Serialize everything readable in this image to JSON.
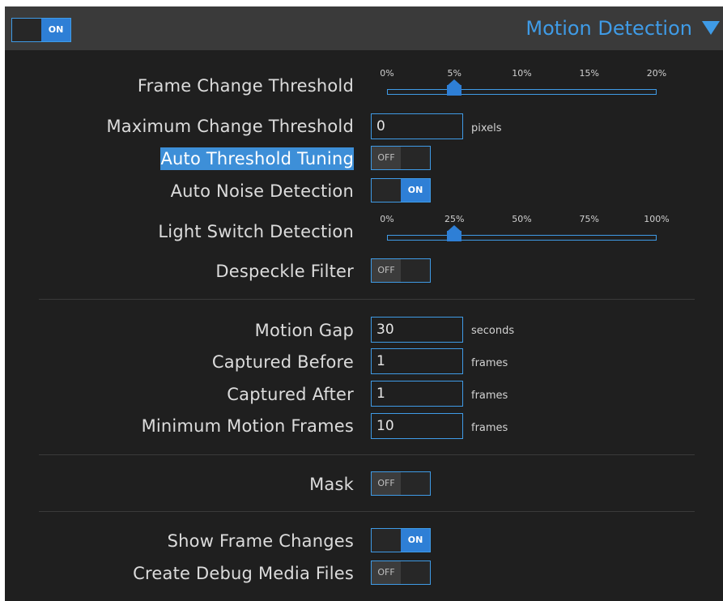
{
  "header": {
    "title": "Motion Detection",
    "enabled": true,
    "enabled_label": "ON"
  },
  "settings": {
    "frame_change_threshold": {
      "label": "Frame Change Threshold",
      "ticks": [
        "0%",
        "5%",
        "10%",
        "15%",
        "20%"
      ],
      "value_percent": 5
    },
    "maximum_change_threshold": {
      "label": "Maximum Change Threshold",
      "value": "0",
      "unit": "pixels"
    },
    "auto_threshold_tuning": {
      "label": "Auto Threshold Tuning",
      "state": "OFF"
    },
    "auto_noise_detection": {
      "label": "Auto Noise Detection",
      "state": "ON"
    },
    "light_switch_detection": {
      "label": "Light Switch Detection",
      "ticks": [
        "0%",
        "25%",
        "50%",
        "75%",
        "100%"
      ],
      "value_percent": 25
    },
    "despeckle_filter": {
      "label": "Despeckle Filter",
      "state": "OFF"
    },
    "motion_gap": {
      "label": "Motion Gap",
      "value": "30",
      "unit": "seconds"
    },
    "captured_before": {
      "label": "Captured Before",
      "value": "1",
      "unit": "frames"
    },
    "captured_after": {
      "label": "Captured After",
      "value": "1",
      "unit": "frames"
    },
    "minimum_motion_frames": {
      "label": "Minimum Motion Frames",
      "value": "10",
      "unit": "frames"
    },
    "mask": {
      "label": "Mask",
      "state": "OFF"
    },
    "show_frame_changes": {
      "label": "Show Frame Changes",
      "state": "ON"
    },
    "create_debug_media_files": {
      "label": "Create Debug Media Files",
      "state": "OFF"
    }
  },
  "colors": {
    "accent": "#3f9be6",
    "panel": "#1f1f1f",
    "header": "#3a3a3a",
    "toggle_on": "#2e7fd6",
    "selection": "#3d8fd8"
  }
}
